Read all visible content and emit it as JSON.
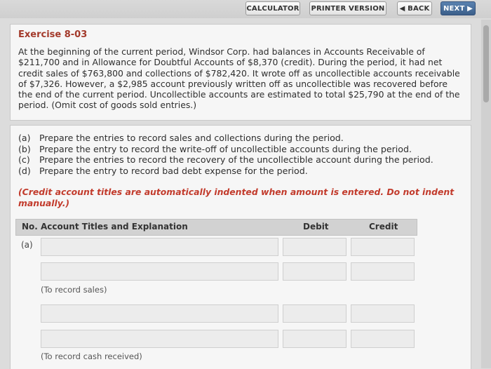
{
  "toolbar": {
    "calculator_label": "CALCULATOR",
    "printer_label": "PRINTER VERSION",
    "back_label": "◀ BACK",
    "next_label": "NEXT ▶"
  },
  "exercise": {
    "title": "Exercise 8-03",
    "problem": "At the beginning of the current period, Windsor Corp. had balances in Accounts Receivable of $211,700 and in Allowance for Doubtful Accounts of $8,370 (credit). During the period, it had net credit sales of $763,800 and collections of $782,420. It wrote off as uncollectible accounts receivable of $7,326. However, a $2,985 account previously written off as uncollectible was recovered before the end of the current period. Uncollectible accounts are estimated to total $25,790 at the end of the period. (Omit cost of goods sold entries.)"
  },
  "requirements": [
    {
      "letter": "(a)",
      "text": "Prepare the entries to record sales and collections during the period."
    },
    {
      "letter": "(b)",
      "text": "Prepare the entry to record the write-off of uncollectible accounts during the period."
    },
    {
      "letter": "(c)",
      "text": "Prepare the entries to record the recovery of the uncollectible account during the period."
    },
    {
      "letter": "(d)",
      "text": "Prepare the entry to record bad debt expense for the period."
    }
  ],
  "note": "(Credit account titles are automatically indented when amount is entered. Do not indent manually.)",
  "table": {
    "headers": {
      "no": "No.",
      "account": "Account Titles and Explanation",
      "debit": "Debit",
      "credit": "Credit"
    },
    "row_label": "(a)",
    "explanations": [
      "(To record sales)",
      "(To record cash received)"
    ]
  }
}
